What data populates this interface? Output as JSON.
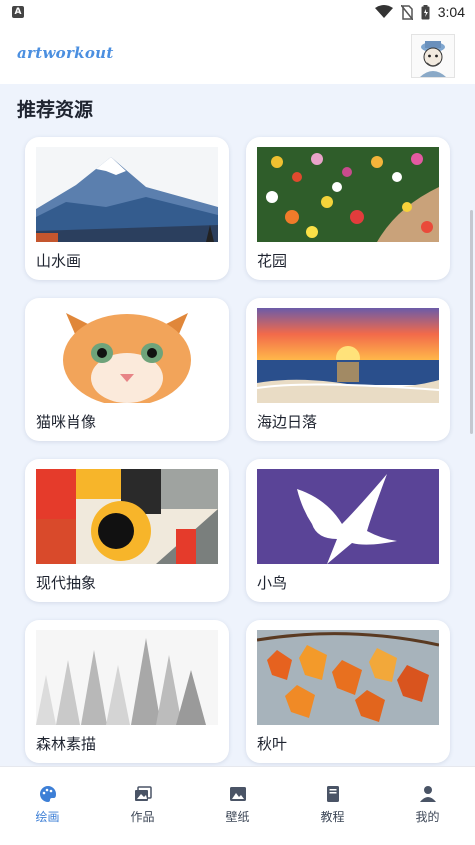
{
  "status_bar": {
    "time": "3:04",
    "notification_badge": "A"
  },
  "header": {
    "logo_text": "artworkout",
    "avatar": "user-avatar-sketch"
  },
  "section": {
    "title": "推荐资源"
  },
  "cards": [
    {
      "label": "山水画",
      "thumb": "mountain-landscape"
    },
    {
      "label": "花园",
      "thumb": "flower-garden"
    },
    {
      "label": "猫咪肖像",
      "thumb": "cat-portrait"
    },
    {
      "label": "海边日落",
      "thumb": "seaside-sunset"
    },
    {
      "label": "现代抽象",
      "thumb": "modern-abstract"
    },
    {
      "label": "小鸟",
      "thumb": "bird-silhouette"
    },
    {
      "label": "森林素描",
      "thumb": "forest-sketch"
    },
    {
      "label": "秋叶",
      "thumb": "autumn-leaves"
    }
  ],
  "bottom_nav": [
    {
      "label": "绘画",
      "icon": "palette-icon",
      "active": true
    },
    {
      "label": "作品",
      "icon": "gallery-icon",
      "active": false
    },
    {
      "label": "壁纸",
      "icon": "image-icon",
      "active": false
    },
    {
      "label": "教程",
      "icon": "book-icon",
      "active": false
    },
    {
      "label": "我的",
      "icon": "person-icon",
      "active": false
    }
  ],
  "colors": {
    "accent": "#3d7fd6",
    "background": "#eef3fc",
    "logo": "#4b8fe0"
  }
}
